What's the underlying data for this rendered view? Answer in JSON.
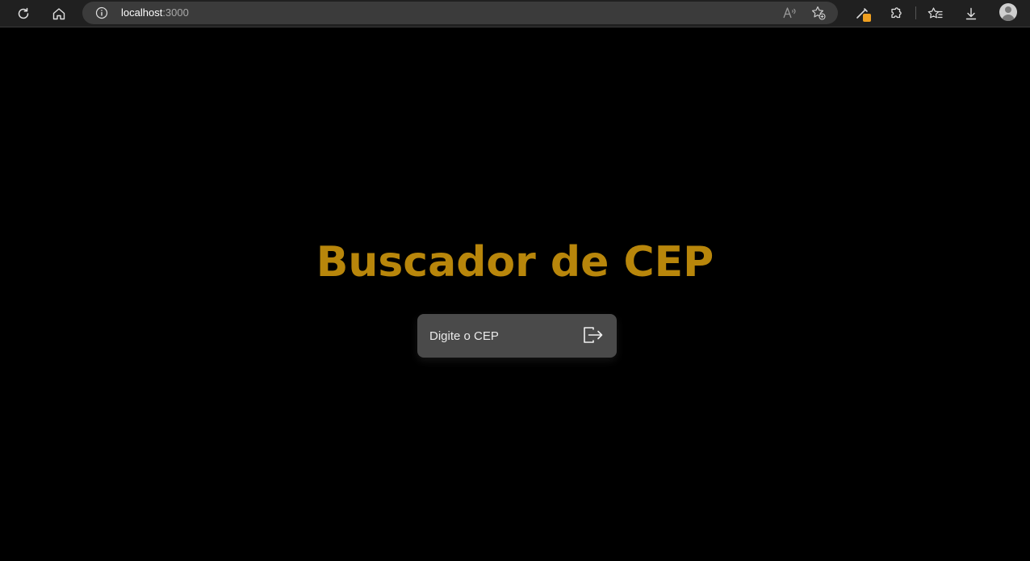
{
  "browser": {
    "url_host": "localhost",
    "url_port": ":3000",
    "icons": [
      "refresh-icon",
      "home-icon",
      "info-icon",
      "read-aloud-icon",
      "add-favorite-icon",
      "extension-tool-icon",
      "extensions-icon",
      "favorites-icon",
      "downloads-icon",
      "profile-icon"
    ],
    "badge_color": "#f0a020"
  },
  "main": {
    "title": "Buscador de CEP",
    "title_color": "#b8860b",
    "search": {
      "placeholder": "Digite o CEP",
      "value": ""
    },
    "submit_icon": "sign-in-arrow-icon"
  }
}
